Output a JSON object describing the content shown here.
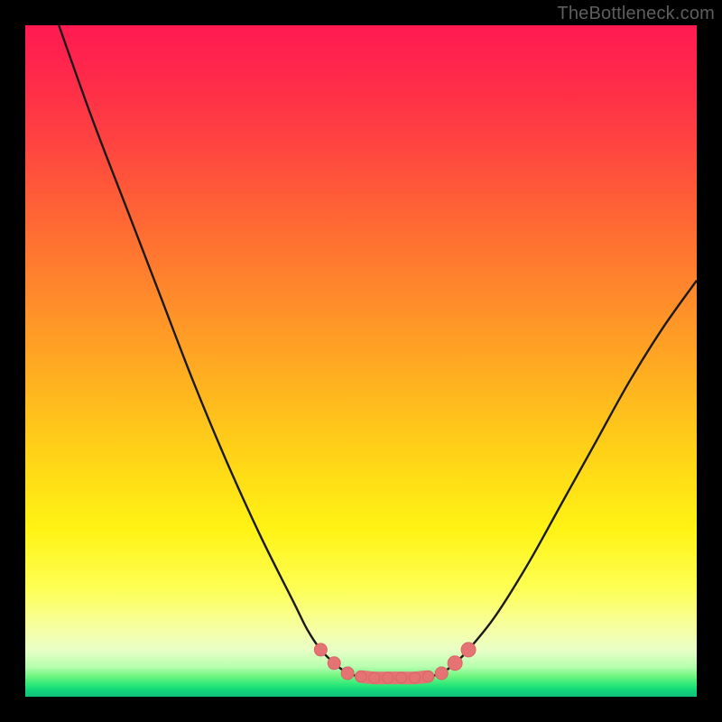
{
  "watermark": "TheBottleneck.com",
  "colors": {
    "frame": "#000000",
    "curve_stroke": "#1a1a1a",
    "marker_fill": "#e57373",
    "marker_stroke": "#d86666"
  },
  "chart_data": {
    "type": "line",
    "title": "",
    "xlabel": "",
    "ylabel": "",
    "xlim": [
      0,
      100
    ],
    "ylim": [
      0,
      100
    ],
    "note": "Axes unlabeled in source image; x/y are estimated normalized 0–100. y≈0 at bottom (green), y=100 at top (red). Curve read off pixel positions.",
    "series": [
      {
        "name": "bottleneck-curve-left",
        "x": [
          5,
          10,
          15,
          20,
          25,
          30,
          35,
          40,
          42,
          44,
          46,
          48,
          50
        ],
        "y": [
          100,
          86,
          73,
          60,
          47,
          35,
          24,
          14,
          10,
          7,
          5,
          3.5,
          3
        ]
      },
      {
        "name": "bottleneck-curve-flat",
        "x": [
          50,
          52,
          54,
          56,
          58,
          60
        ],
        "y": [
          3,
          2.8,
          2.8,
          2.8,
          2.8,
          3
        ]
      },
      {
        "name": "bottleneck-curve-right",
        "x": [
          60,
          62,
          64,
          66,
          70,
          75,
          80,
          85,
          90,
          95,
          100
        ],
        "y": [
          3,
          3.5,
          5,
          7,
          12,
          20,
          29,
          38,
          47,
          55,
          62
        ]
      }
    ],
    "markers": {
      "name": "highlight-dots",
      "x": [
        44,
        46,
        48,
        50,
        52,
        54,
        56,
        58,
        60,
        62,
        64,
        66
      ],
      "y": [
        7,
        5,
        3.5,
        3,
        2.8,
        2.8,
        2.8,
        2.8,
        3,
        3.5,
        5,
        7
      ],
      "r": [
        7,
        7,
        7,
        6,
        6,
        6,
        6,
        6,
        6,
        7,
        8,
        8
      ]
    }
  }
}
